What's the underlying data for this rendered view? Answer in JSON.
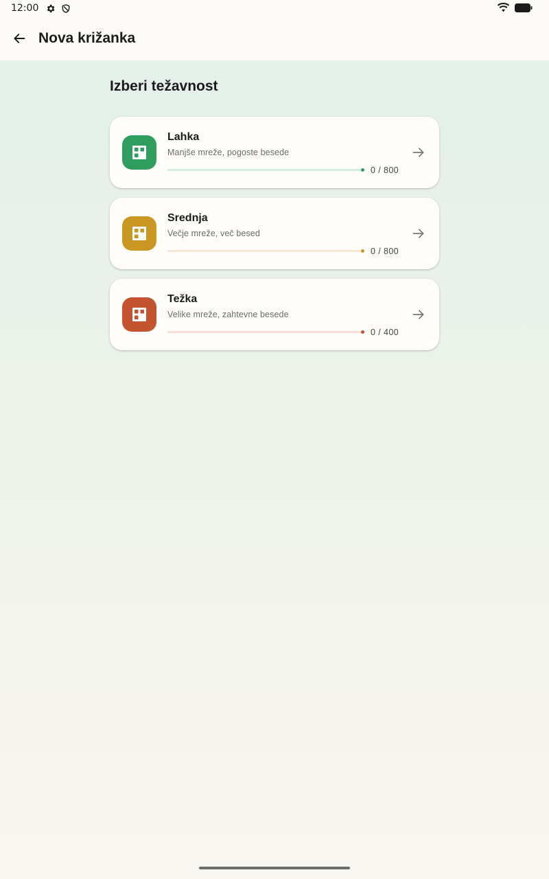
{
  "status_bar": {
    "time": "12:00"
  },
  "app_bar": {
    "title": "Nova križanka"
  },
  "section": {
    "title": "Izberi težavnost"
  },
  "levels": [
    {
      "title": "Lahka",
      "subtitle": "Manjše mreže, pogoste besede",
      "progress": "0 / 800",
      "solved": 0,
      "total": 800,
      "color": "#2e9d5e",
      "track_color": "#d5ebdf",
      "dot_color": "#2e9d5e"
    },
    {
      "title": "Srednja",
      "subtitle": "Večje mreže, več besed",
      "progress": "0 / 800",
      "solved": 0,
      "total": 800,
      "color": "#c99722",
      "track_color": "#f5e6d6",
      "dot_color": "#c99722"
    },
    {
      "title": "Težka",
      "subtitle": "Velike mreže, zahtevne besede",
      "progress": "0 / 400",
      "solved": 0,
      "total": 400,
      "color": "#c4532f",
      "track_color": "#f5dfd6",
      "dot_color": "#c4532f"
    }
  ],
  "icons": {
    "back": "arrow-left-icon",
    "level": "crossword-grid-icon",
    "go": "arrow-right-icon"
  }
}
